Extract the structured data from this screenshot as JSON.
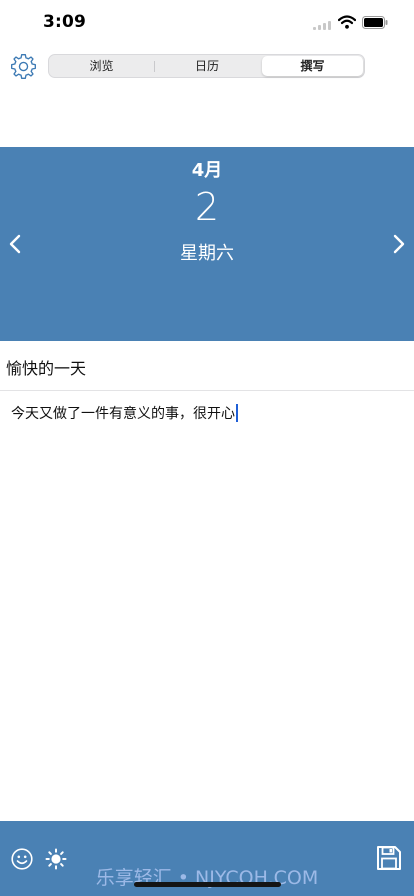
{
  "status_bar": {
    "time": "3:09"
  },
  "header": {
    "settings_icon": "gear-icon",
    "tabs": [
      {
        "label": "浏览",
        "selected": false
      },
      {
        "label": "日历",
        "selected": false
      },
      {
        "label": "撰写",
        "selected": true
      }
    ]
  },
  "date": {
    "month": "4月",
    "day": "2",
    "weekday": "星期六"
  },
  "nav": {
    "prev_icon": "chevron-left-icon",
    "next_icon": "chevron-right-icon"
  },
  "entry": {
    "title": "愉快的一天",
    "body": "今天又做了一件有意义的事，很开心"
  },
  "toolbar": {
    "icons": [
      "smiley-icon",
      "sun-icon",
      "save-icon"
    ],
    "watermark": "乐享轻汇 • NJYCQH.COM"
  },
  "colors": {
    "accent": "#4a81b4",
    "caret": "#1f5fd6",
    "segment_bg": "#ececed"
  }
}
